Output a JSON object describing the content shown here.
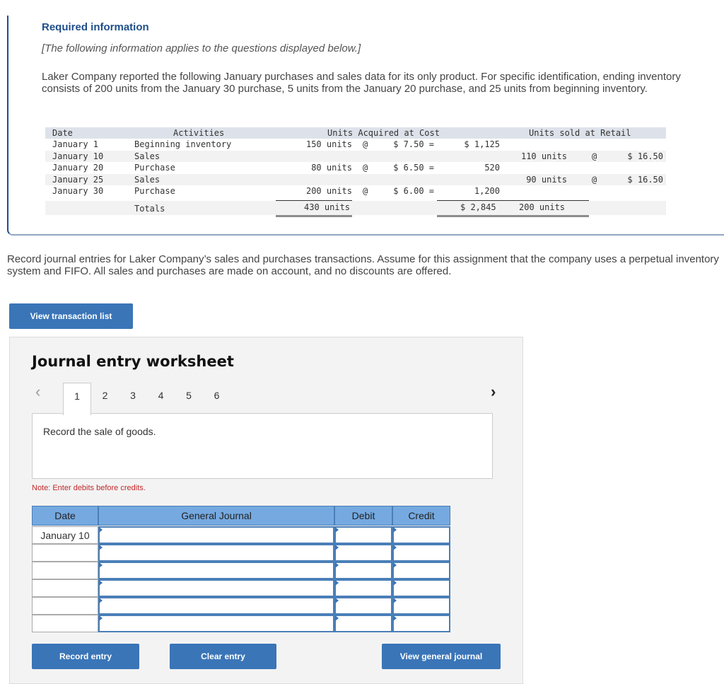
{
  "required_info": {
    "title": "Required information",
    "subtitle": "[The following information applies to the questions displayed below.]",
    "body": "Laker Company reported the following January purchases and sales data for its only product. For specific identification, ending inventory consists of 200 units from the January 30 purchase, 5 units from the January 20 purchase, and 25 units from beginning inventory."
  },
  "data_table": {
    "headers": {
      "date": "Date",
      "activities": "Activities",
      "acquired": "Units Acquired at Cost",
      "sold": "Units sold at Retail"
    },
    "rows": [
      {
        "date": "January 1",
        "activity": "Beginning inventory",
        "acq_units": "150 units",
        "acq_at": "@",
        "acq_cost": "$ 7.50 =",
        "acq_total": "$ 1,125",
        "sold_units": "",
        "sold_at": "",
        "sold_price": ""
      },
      {
        "date": "January 10",
        "activity": "Sales",
        "acq_units": "",
        "acq_at": "",
        "acq_cost": "",
        "acq_total": "",
        "sold_units": "110 units",
        "sold_at": "@",
        "sold_price": "$ 16.50"
      },
      {
        "date": "January 20",
        "activity": "Purchase",
        "acq_units": "80 units",
        "acq_at": "@",
        "acq_cost": "$ 6.50 =",
        "acq_total": "520",
        "sold_units": "",
        "sold_at": "",
        "sold_price": ""
      },
      {
        "date": "January 25",
        "activity": "Sales",
        "acq_units": "",
        "acq_at": "",
        "acq_cost": "",
        "acq_total": "",
        "sold_units": "90 units",
        "sold_at": "@",
        "sold_price": "$ 16.50"
      },
      {
        "date": "January 30",
        "activity": "Purchase",
        "acq_units": "200 units",
        "acq_at": "@",
        "acq_cost": "$ 6.00 =",
        "acq_total": "1,200",
        "sold_units": "",
        "sold_at": "",
        "sold_price": ""
      }
    ],
    "totals": {
      "label": "Totals",
      "acq_units": "430 units",
      "acq_total": "$ 2,845",
      "sold_units": "200 units"
    }
  },
  "instructions": "Record journal entries for Laker Company’s sales and purchases transactions. Assume for this assignment that the company uses a perpetual inventory system and FIFO. All sales and purchases are made on account, and no discounts are offered.",
  "view_transaction_list_label": "View transaction list",
  "worksheet": {
    "title": "Journal entry worksheet",
    "tabs": [
      "1",
      "2",
      "3",
      "4",
      "5",
      "6"
    ],
    "active_tab": "1",
    "prev_icon": "‹",
    "next_icon": "›",
    "description": "Record the sale of goods.",
    "note": "Note: Enter debits before credits.",
    "columns": {
      "date": "Date",
      "journal": "General Journal",
      "debit": "Debit",
      "credit": "Credit"
    },
    "rows": [
      {
        "date": "January 10",
        "account": "",
        "debit": "",
        "credit": ""
      },
      {
        "date": "",
        "account": "",
        "debit": "",
        "credit": ""
      },
      {
        "date": "",
        "account": "",
        "debit": "",
        "credit": ""
      },
      {
        "date": "",
        "account": "",
        "debit": "",
        "credit": ""
      },
      {
        "date": "",
        "account": "",
        "debit": "",
        "credit": ""
      },
      {
        "date": "",
        "account": "",
        "debit": "",
        "credit": ""
      }
    ],
    "buttons": {
      "record": "Record entry",
      "clear": "Clear entry",
      "view_journal": "View general journal"
    }
  },
  "colors": {
    "accent_blue": "#3a75b8",
    "header_blue": "#75a9e0",
    "title_navy": "#1f4f8b",
    "note_red": "#c0292b"
  }
}
